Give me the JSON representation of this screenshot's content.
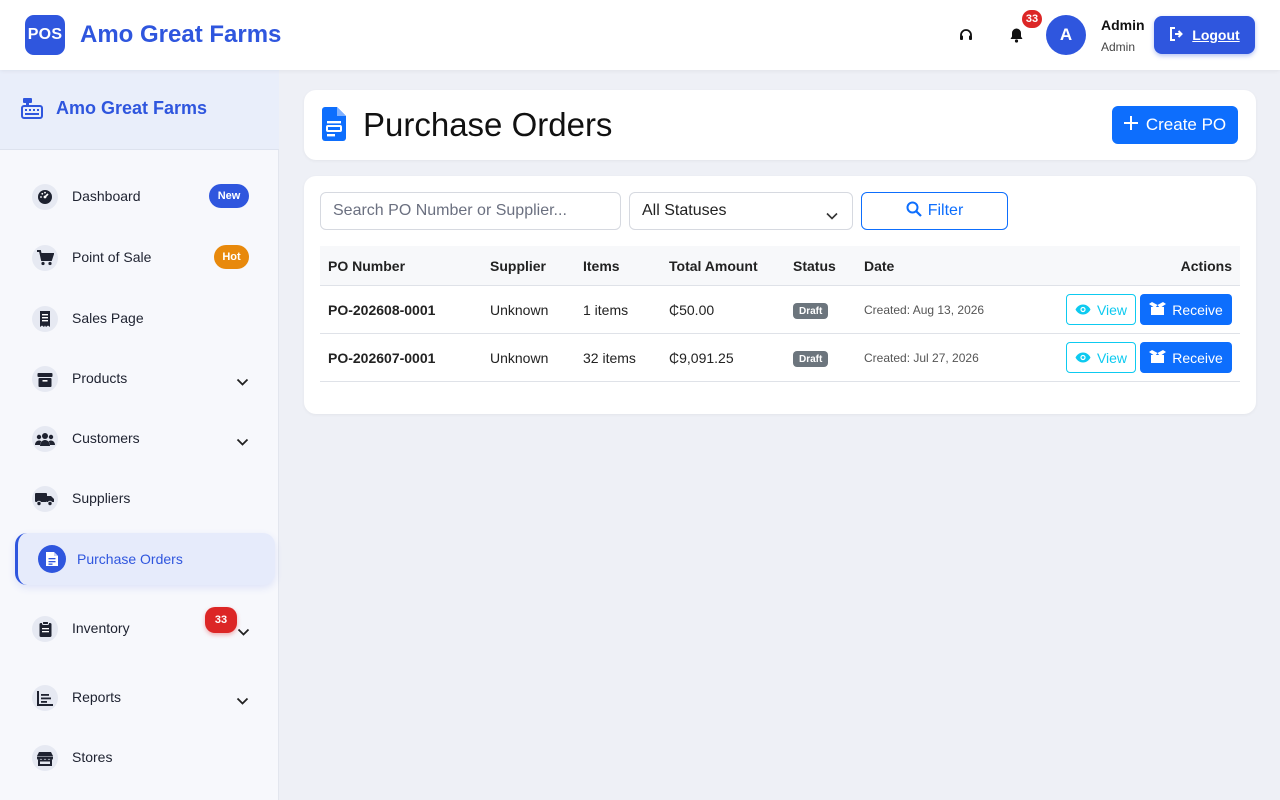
{
  "app": {
    "logo_text": "POS",
    "name": "Amo Great Farms"
  },
  "topbar": {
    "notification_count": "33",
    "avatar_initial": "A",
    "user_name": "Admin",
    "user_role": "Admin",
    "logout_label": "Logout"
  },
  "sidebar": {
    "brand": "Amo Great Farms",
    "items": [
      {
        "label": "Dashboard",
        "icon": "gauge-icon",
        "badge": "New",
        "badge_color": "#2f56de"
      },
      {
        "label": "Point of Sale",
        "icon": "cart-icon",
        "badge": "Hot",
        "badge_color": "#e8890c"
      },
      {
        "label": "Sales Page",
        "icon": "receipt-icon"
      },
      {
        "label": "Products",
        "icon": "box-icon",
        "expandable": true
      },
      {
        "label": "Customers",
        "icon": "users-icon",
        "expandable": true
      },
      {
        "label": "Suppliers",
        "icon": "truck-icon"
      },
      {
        "label": "Purchase Orders",
        "icon": "file-invoice-icon",
        "active": true
      },
      {
        "label": "Inventory",
        "icon": "clipboard-icon",
        "badge": "33",
        "badge_color": "#dc2626",
        "expandable": true
      },
      {
        "label": "Reports",
        "icon": "chart-icon",
        "expandable": true
      },
      {
        "label": "Stores",
        "icon": "store-icon"
      }
    ]
  },
  "page": {
    "title": "Purchase Orders",
    "create_label": "Create PO"
  },
  "filters": {
    "search_placeholder": "Search PO Number or Supplier...",
    "status_selected": "All Statuses",
    "filter_label": "Filter"
  },
  "table": {
    "columns": [
      "PO Number",
      "Supplier",
      "Items",
      "Total Amount",
      "Status",
      "Date",
      "Actions"
    ],
    "rows": [
      {
        "po_number": "PO-202608-0001",
        "supplier": "Unknown",
        "items": "1 items",
        "total": "₵50.00",
        "status": "Draft",
        "date": "Created: Aug 13, 2026"
      },
      {
        "po_number": "PO-202607-0001",
        "supplier": "Unknown",
        "items": "32 items",
        "total": "₵9,091.25",
        "status": "Draft",
        "date": "Created: Jul 27, 2026"
      }
    ],
    "view_label": "View",
    "receive_label": "Receive"
  },
  "colors": {
    "primary": "#2f56de",
    "button_blue": "#0d6efd",
    "info": "#0dcaf0",
    "draft_gray": "#6c757d",
    "danger": "#dc2626"
  }
}
